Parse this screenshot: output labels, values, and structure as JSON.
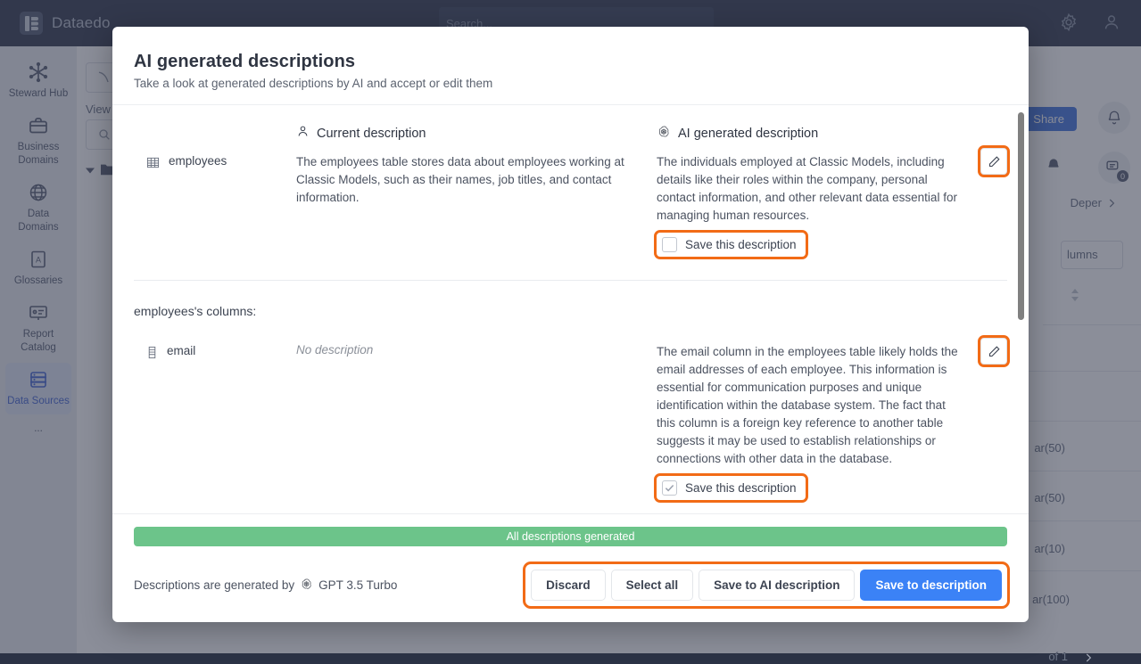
{
  "app": {
    "brand": "Dataedo",
    "search_placeholder": "Search...",
    "sidebar_items": [
      {
        "label": "Steward Hub",
        "icon": "asterisk-icon",
        "active": false
      },
      {
        "label": "Business Domains",
        "icon": "briefcase-icon",
        "active": false
      },
      {
        "label": "Data Domains",
        "icon": "globe-icon",
        "active": false
      },
      {
        "label": "Glossaries",
        "icon": "book-icon",
        "active": false
      },
      {
        "label": "Report Catalog",
        "icon": "report-icon",
        "active": false
      },
      {
        "label": "Data Sources",
        "icon": "database-list-icon",
        "active": true
      },
      {
        "label": "...",
        "icon": "more-icon",
        "active": false
      }
    ],
    "share_label": "Share",
    "view_label": "View",
    "breadcrumb_tail": "Deper",
    "columns_tab": "lumns",
    "notification_count": "0",
    "bg_types": [
      "ar(50)",
      "ar(50)",
      "ar(10)",
      "ar(100)"
    ],
    "pager_label": "of 1"
  },
  "modal": {
    "title": "AI generated descriptions",
    "subtitle": "Take a look at generated descriptions by AI and accept or edit them",
    "columns": {
      "current": "Current description",
      "ai": "AI generated description",
      "current_icon": "person-icon",
      "ai_icon": "openai-icon"
    },
    "table_row": {
      "name": "employees",
      "icon": "table-icon",
      "current_description": "The employees table stores data about employees working at Classic Models, such as their names, job titles, and contact information.",
      "ai_description": "The individuals employed at Classic Models, including details like their roles within the company, personal contact information, and other relevant data essential for managing human resources.",
      "save_label": "Save this description",
      "save_checked": false,
      "edit_icon": "pencil-icon"
    },
    "columns_section_title": "employees's columns:",
    "column_rows": [
      {
        "name": "email",
        "icon": "column-icon",
        "current_description": "No description",
        "current_is_empty": true,
        "ai_description": "The email column in the employees table likely holds the email addresses of each employee. This information is essential for communication purposes and unique identification within the database system. The fact that this column is a foreign key reference to another table suggests it may be used to establish relationships or connections with other data in the database.",
        "save_label": "Save this description",
        "save_checked": true,
        "edit_icon": "pencil-icon"
      }
    ],
    "status_bar": "All descriptions generated",
    "generated_by_prefix": "Descriptions are generated by",
    "generated_by_model": "GPT 3.5 Turbo",
    "actions": [
      {
        "label": "Discard",
        "primary": false
      },
      {
        "label": "Select all",
        "primary": false
      },
      {
        "label": "Save to AI description",
        "primary": false
      },
      {
        "label": "Save to description",
        "primary": true
      }
    ]
  },
  "colors": {
    "highlight": "#f26b16",
    "primary": "#3b82f6",
    "success": "#6cc48a",
    "topbar": "#3a4256"
  }
}
